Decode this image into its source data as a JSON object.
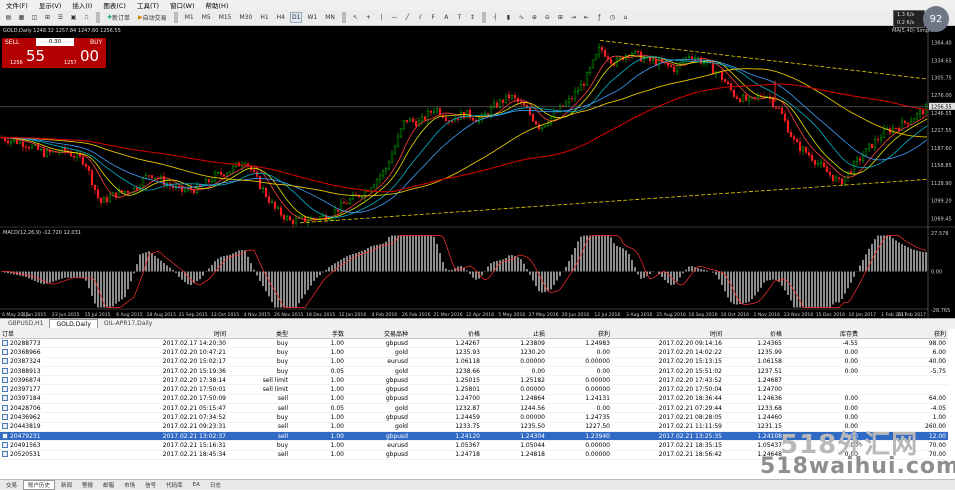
{
  "menubar": [
    "文件(F)",
    "显示(V)",
    "插入(I)",
    "图表(C)",
    "工具(T)",
    "窗口(W)",
    "帮助(H)"
  ],
  "toolbar": {
    "new_order": "新订单",
    "auto_trading": "自动交易",
    "timeframes": [
      "M1",
      "M5",
      "M15",
      "M30",
      "H1",
      "H4",
      "D1",
      "W1",
      "MN"
    ],
    "active_timeframe": "D1"
  },
  "chart": {
    "title": "GOLD,Daily  1248.32 1257.84 1247.60 1256.55",
    "right_label": "MA(5,40) Simple",
    "trade_panel": {
      "sell_label": "SELL",
      "buy_label": "BUY",
      "lot": "0.30",
      "sell_small": "1256",
      "sell_big": "55",
      "buy_small": "1257",
      "buy_big": "00"
    },
    "price_axis": [
      "1364.40",
      "1334.65",
      "1305.75",
      "1276.00",
      "1246.55",
      "1217.55",
      "1187.60",
      "1158.85",
      "1128.90",
      "1099.20",
      "1069.45"
    ],
    "current_price": "1256.55",
    "macd_title": "MACD(12,26,9) -12.720 12.031",
    "macd_axis": [
      "27.578",
      "0.00",
      "-28.765"
    ],
    "date_axis": [
      "6 May 2015",
      "1 Jun 2015",
      "23 Jun 2015",
      "15 Jul 2015",
      "6 Aug 2015",
      "28 Aug 2015",
      "21 Sep 2015",
      "13 Oct 2015",
      "4 Nov 2015",
      "26 Nov 2015",
      "18 Dec 2015",
      "12 Jan 2016",
      "4 Feb 2016",
      "26 Feb 2016",
      "21 Mar 2016",
      "12 Apr 2016",
      "5 May 2016",
      "27 May 2016",
      "20 Jun 2016",
      "12 Jul 2016",
      "3 Aug 2016",
      "25 Aug 2016",
      "16 Sep 2016",
      "10 Oct 2016",
      "1 Nov 2016",
      "23 Nov 2016",
      "15 Dec 2016",
      "10 Jan 2017",
      "1 Feb 2017",
      "23 Feb 2017"
    ],
    "colors": {
      "bull": "#00c800",
      "bear": "#ff2020",
      "ma_yellow": "#e6c200",
      "ma_red": "#c80000",
      "ma_cyan": "#00b4c8",
      "trend": "#e6d200",
      "macd_hist": "#c8c8c8",
      "macd_signal": "#ff3030"
    }
  },
  "chart_tabs": [
    "GBPUSD,H1",
    "GOLD,Daily",
    "OIL-APR17,Daily"
  ],
  "active_chart_tab": "GOLD,Daily",
  "table": {
    "headers": [
      "订单",
      "时间",
      "类型",
      "手数",
      "交易品种",
      "价格",
      "止损",
      "获利",
      "时间",
      "价格",
      "库存费",
      "获利"
    ],
    "rows": [
      [
        "20288773",
        "2017.02.17 14:20:30",
        "buy",
        "1.00",
        "gbpusd",
        "1.24267",
        "1.23809",
        "1.24983",
        "2017.02.20 09:14:16",
        "1.24365",
        "-4.55",
        "98.00"
      ],
      [
        "20368966",
        "2017.02.20 10:47:21",
        "buy",
        "1.00",
        "gold",
        "1235.93",
        "1230.20",
        "0.00",
        "2017.02.20 14:02:22",
        "1235.99",
        "0.00",
        "6.00"
      ],
      [
        "20387324",
        "2017.02.20 15:02:17",
        "buy",
        "1.00",
        "eurusd",
        "1.06118",
        "0.00000",
        "0.00000",
        "2017.02.20 15:13:15",
        "1.06158",
        "0.00",
        "40.00"
      ],
      [
        "20388913",
        "2017.02.20 15:19:36",
        "buy",
        "0.05",
        "gold",
        "1238.66",
        "0.00",
        "0.00",
        "2017.02.20 15:51:02",
        "1237.51",
        "0.00",
        "-5.75"
      ],
      [
        "20396874",
        "2017.02.20 17:38:14",
        "sell limit",
        "1.00",
        "gbpusd",
        "1.25015",
        "1.25182",
        "0.00000",
        "2017.02.20 17:43:52",
        "1.24687",
        "",
        ""
      ],
      [
        "20397177",
        "2017.02.20 17:50:01",
        "sell limit",
        "1.00",
        "gbpusd",
        "1.25801",
        "0.00000",
        "0.00000",
        "2017.02.20 17:50:04",
        "1.24700",
        "",
        ""
      ],
      [
        "20397184",
        "2017.02.20 17:50:09",
        "sell",
        "1.00",
        "gbpusd",
        "1.24700",
        "1.24864",
        "1.24131",
        "2017.02.20 18:36:44",
        "1.24636",
        "0.00",
        "64.00"
      ],
      [
        "20428706",
        "2017.02.21 05:15:47",
        "sell",
        "0.05",
        "gold",
        "1232.87",
        "1244.56",
        "0.00",
        "2017.02.21 07:29:44",
        "1233.68",
        "0.00",
        "-4.05"
      ],
      [
        "20436962",
        "2017.02.21 07:34:52",
        "buy",
        "1.00",
        "gbpusd",
        "1.24459",
        "0.00000",
        "1.24735",
        "2017.02.21 08:28:05",
        "1.24460",
        "0.00",
        "1.00"
      ],
      [
        "20443819",
        "2017.02.21 09:23:31",
        "sell",
        "1.00",
        "gold",
        "1233.75",
        "1235.50",
        "1227.50",
        "2017.02.21 11:11:59",
        "1231.15",
        "0.00",
        "260.00"
      ],
      [
        "20479231",
        "2017.02.21 13:02:37",
        "sell",
        "1.00",
        "gbpusd",
        "1.24120",
        "1.24304",
        "1.23940",
        "2017.02.21 13:25:35",
        "1.24108",
        "0.00",
        "12.00"
      ],
      [
        "20491563",
        "2017.02.21 15:16:31",
        "buy",
        "1.00",
        "eurusd",
        "1.05367",
        "1.05044",
        "0.00000",
        "2017.02.21 18:35:15",
        "1.05437",
        "0.00",
        "70.00"
      ],
      [
        "20520531",
        "2017.02.21 18:45:34",
        "sell",
        "1.00",
        "gbpusd",
        "1.24718",
        "1.24818",
        "0.00000",
        "2017.02.21 18:56:42",
        "1.24648",
        "0.00",
        "70.00"
      ]
    ],
    "highlighted_row": 10
  },
  "bottom_tabs": [
    "交易",
    "账户历史",
    "新闻",
    "警报",
    "邮箱",
    "市场",
    "信号",
    "代码库",
    "EA",
    "日志"
  ],
  "active_bottom_tab": "账户历史",
  "gauge": "92",
  "net_status": [
    "1.3 K/s",
    "0.2 K/s"
  ],
  "watermark": {
    "line1": "518外汇网",
    "line2": "518waihui.com"
  }
}
